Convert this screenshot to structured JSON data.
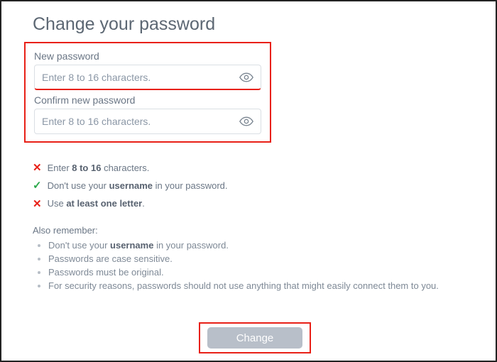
{
  "title": "Change your password",
  "fields": {
    "new_password": {
      "label": "New password",
      "placeholder": "Enter 8 to 16 characters.",
      "value": ""
    },
    "confirm_password": {
      "label": "Confirm new password",
      "placeholder": "Enter 8 to 16 characters.",
      "value": ""
    }
  },
  "rules": {
    "r1_pre": "Enter ",
    "r1_bold": "8 to 16",
    "r1_post": " characters.",
    "r2_pre": "Don't use your ",
    "r2_bold": "username",
    "r2_post": " in your password.",
    "r3_pre": "Use ",
    "r3_bold": "at least one letter",
    "r3_post": "."
  },
  "remember": {
    "title": "Also remember:",
    "i1_pre": "Don't use your ",
    "i1_bold": "username",
    "i1_post": " in your password.",
    "i2": "Passwords are case sensitive.",
    "i3": "Passwords must be original.",
    "i4": "For security reasons, passwords should not use anything that might easily connect them to you."
  },
  "button": "Change"
}
